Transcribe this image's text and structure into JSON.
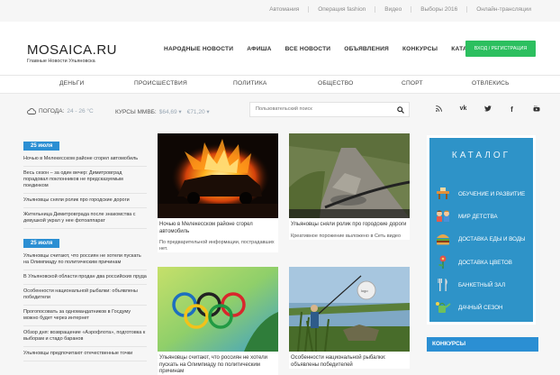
{
  "topbar": {
    "links": [
      "Автомания",
      "Операция fashion",
      "Видео",
      "Выборы 2016",
      "Онлайн-трансляции"
    ]
  },
  "header": {
    "logo": "MOSAICA.RU",
    "tagline": "Главные Новости Ульяновска",
    "nav": [
      "НАРОДНЫЕ НОВОСТИ",
      "АФИША",
      "ВСЕ НОВОСТИ",
      "ОБЪЯВЛЕНИЯ",
      "КОНКУРСЫ",
      "КАТАЛОГ"
    ],
    "login": "ВХОД / РЕГИСТРАЦИЯ"
  },
  "catnav": [
    "ДЕНЬГИ",
    "ПРОИСШЕСТВИЯ",
    "ПОЛИТИКА",
    "ОБЩЕСТВО",
    "СПОРТ",
    "ОТВЛЕКИСЬ"
  ],
  "toolbar": {
    "weather_label": "ПОГОДА:",
    "weather_value": "24 - 26 °С",
    "rates_label": "КУРСЫ ММВБ:",
    "usd": "$64,69 ▾",
    "eur": "€71,20 ▾",
    "search_placeholder": "Пользовательский поиск"
  },
  "socials": [
    "rss-icon",
    "vk-icon",
    "twitter-icon",
    "facebook-icon",
    "youtube-icon"
  ],
  "leftcol": {
    "date1": "25 июля",
    "items1": [
      "Ночью в Мелекесском районе сгорел автомобиль",
      "Весь сезон – за один вечер: Димитровград порадовал поклонников не предсказуемым поединком",
      "Ульяновцы сняли ролик про городские дороги",
      "Жительница Димитровграда после знакомства с девушкой украл у нее фотоаппарат"
    ],
    "date2": "25 июля",
    "items2": [
      "Ульяновцы считают, что россиян не хотели пускать на Олимпиаду по политическим причинам",
      "В Ульяновской области продан два российских пруда",
      "Особенности национальной рыбалки: объявлены победители",
      "Прогопосовать за одномандатников в Госдуму можно будет через интернет",
      "Обзор дня: возвращение «Аэрофлота», подготовка к выборам и стадо баранов",
      "Ульяновцы предпочитают отечественные точки"
    ]
  },
  "cards": [
    {
      "title": "Ночью в Мелекесском районе сгорел автомобиль",
      "desc": "По предварительной информации, пострадавших нет."
    },
    {
      "title": "Ульяновцы сняли ролик про городские дороги",
      "desc": "Креативное порожение выложено в Сеть видео"
    },
    {
      "title": "Ульяновцы считают, что россиян не хотели пускать на Олимпиаду по политическим причинам",
      "desc": ""
    },
    {
      "title": "Особенности национальной рыбалки: объявлены победителей",
      "desc": ""
    }
  ],
  "catalog": {
    "title": "КАТАЛОГ",
    "items": [
      {
        "label": "ОБУЧЕНИЕ И РАЗВИТИЕ",
        "icon": "school-desk-icon"
      },
      {
        "label": "МИР ДЕТСТВА",
        "icon": "children-icon"
      },
      {
        "label": "ДОСТАВКА ЕДЫ И ВОДЫ",
        "icon": "burger-icon"
      },
      {
        "label": "ДОСТАВКА ЦВЕТОВ",
        "icon": "flower-icon"
      },
      {
        "label": "БАНКЕТНЫЙ ЗАЛ",
        "icon": "cutlery-icon"
      },
      {
        "label": "ДАЧНЫЙ СЕЗОН",
        "icon": "watering-can-icon"
      }
    ]
  },
  "konkursy": "КОНКУРСЫ",
  "colors": {
    "accent_blue": "#2b8fd3",
    "login_green": "#2cbf5f",
    "catalog_blue": "#2e93c8"
  }
}
